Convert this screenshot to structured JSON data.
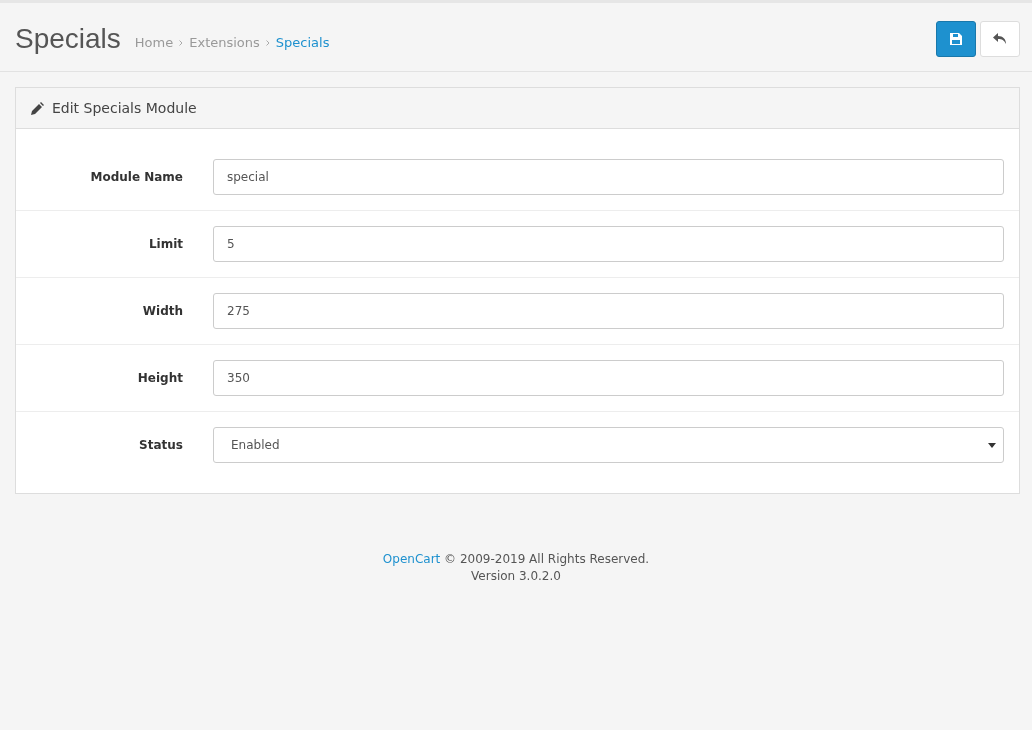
{
  "page": {
    "title": "Specials"
  },
  "breadcrumbs": [
    {
      "label": "Home",
      "selected": false
    },
    {
      "label": "Extensions",
      "selected": false
    },
    {
      "label": "Specials",
      "selected": true
    }
  ],
  "panel": {
    "title": "Edit Specials Module"
  },
  "fields": [
    {
      "kind": "text",
      "label": "Module Name",
      "value": "special"
    },
    {
      "kind": "text",
      "label": "Limit",
      "value": "5"
    },
    {
      "kind": "text",
      "label": "Width",
      "value": "275"
    },
    {
      "kind": "text",
      "label": "Height",
      "value": "350"
    },
    {
      "kind": "select",
      "label": "Status",
      "value": "Enabled"
    }
  ],
  "footer": {
    "link": "OpenCart",
    "text": "© 2009-2019 All Rights Reserved.",
    "version": "Version 3.0.2.0"
  }
}
